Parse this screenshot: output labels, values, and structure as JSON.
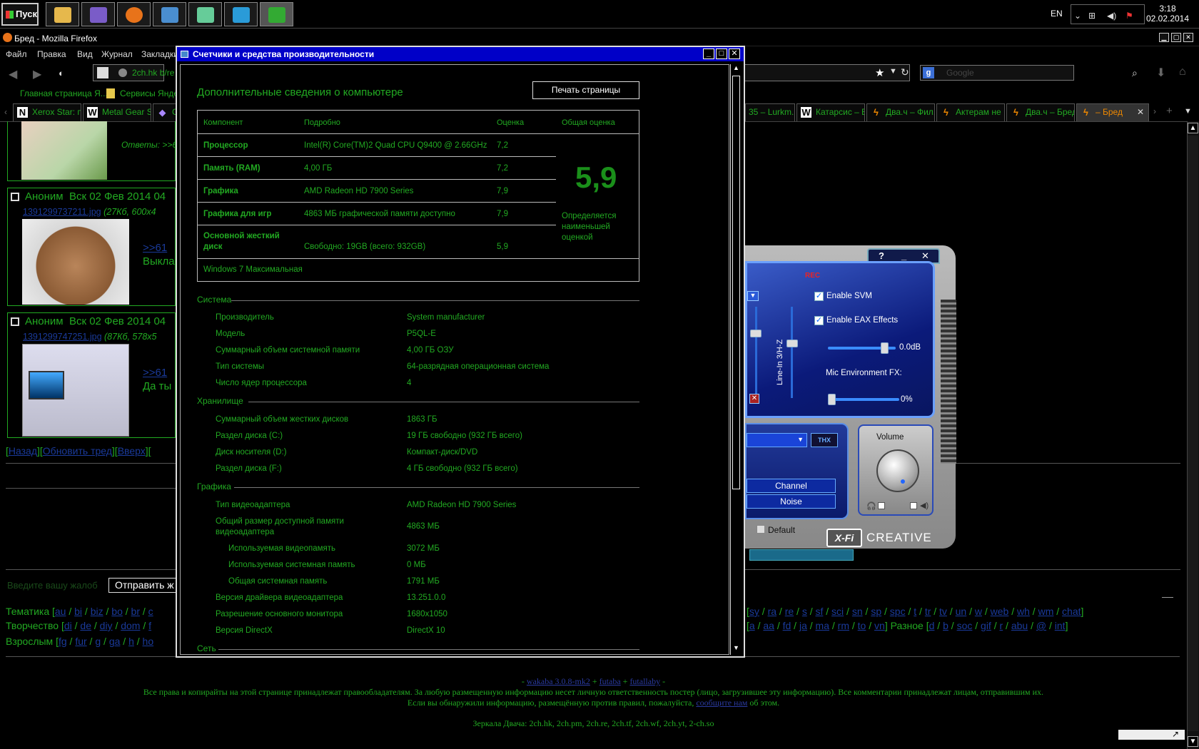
{
  "taskbar": {
    "start_label": "Пуск",
    "apps": [
      {
        "name": "explorer",
        "color": "#e6b84c"
      },
      {
        "name": "visual-studio",
        "color": "#7a5cc8"
      },
      {
        "name": "firefox",
        "color": "#e8731a"
      },
      {
        "name": "control-panel",
        "color": "#4a8ed0"
      },
      {
        "name": "network",
        "color": "#6c9"
      },
      {
        "name": "media",
        "color": "#2a9bd8"
      },
      {
        "name": "performance-monitor",
        "color": "#3a3",
        "active": true
      }
    ],
    "lang": "EN",
    "clock_time": "3:18",
    "clock_date": "02.02.2014"
  },
  "firefox": {
    "title": "Бред - Mozilla Firefox",
    "menu": [
      "Файл",
      "Правка",
      "Вид",
      "Журнал",
      "Закладки"
    ],
    "url": "2ch.hk b/re",
    "search_placeholder": "Google",
    "bookmarks": [
      "Главная страница Я...",
      "Сервисы Яндекс"
    ],
    "tabs_left": [
      "Xerox Star: пу...",
      "Metal Gear S...",
      "Co"
    ],
    "tabs_right": [
      "35 – Lurkm...",
      "Катарсис – В...",
      "Два.ч – Фил...",
      "Актерам не ...",
      "Два.ч – Бред",
      "– Бред"
    ]
  },
  "board": {
    "post1": {
      "replies": "Ответы: >>6"
    },
    "post2": {
      "author": "Аноним",
      "date": "Вск 02 Фев 2014 04",
      "file": "1391299737211.jpg",
      "meta": "(27Кб, 600x4",
      "link": ">>61",
      "text": "Выкла"
    },
    "post3": {
      "author": "Аноним",
      "date": "Вск 02 Фев 2014 04",
      "file": "1391299747251.jpg",
      "meta": "(87Кб, 578x5",
      "link": ">>61",
      "text": "Да ты"
    },
    "nav": {
      "back": "Назад",
      "refresh": "Обновить тред",
      "up": "Вверх"
    },
    "complaint_placeholder": "Введите вашу жалоб",
    "complaint_button": "Отправить ж",
    "boards": {
      "themes_label": "Тематика",
      "themes_left": [
        "au",
        "bi",
        "biz",
        "bo",
        "br",
        "c"
      ],
      "themes_right": [
        "sy",
        "ra",
        "re",
        "s",
        "sf",
        "sci",
        "sn",
        "sp",
        "spc",
        "t",
        "tr",
        "tv",
        "un",
        "w",
        "web",
        "wh",
        "wm",
        "chat"
      ],
      "creative_label": "Творчество",
      "creative_left": [
        "di",
        "de",
        "diy",
        "dom",
        "f"
      ],
      "japan_right": [
        "a",
        "aa",
        "fd",
        "ja",
        "ma",
        "rm",
        "to",
        "vn"
      ],
      "misc_label": "Разное",
      "misc": [
        "d",
        "b",
        "soc",
        "gif",
        "r",
        "abu",
        "@",
        "int"
      ],
      "adult_label": "Взрослым",
      "adult": [
        "fg",
        "fur",
        "g",
        "ga",
        "h",
        "ho"
      ]
    },
    "footer": {
      "engine_left": "wakaba 3.0.8-mk2",
      "engine_mid": "futaba",
      "engine_right": "futallaby",
      "copyright": "Все права и копирайты на этой странице принадлежат правообладателям. За любую размещенную информацию несет личную ответственность постер (лицо, загрузившее эту информацию). Все комментарии принадлежат лицам, отправившим их.",
      "report_prefix": "Если вы обнаружили информацию, размещённую против правил, пожалуйста,",
      "report_link": "сообщите нам",
      "report_suffix": "об этом.",
      "mirrors": "Зеркала Двача: 2ch.hk, 2ch.pm, 2ch.re, 2ch.tf, 2ch.wf, 2ch.yt, 2-ch.so"
    }
  },
  "dialog": {
    "title": "Счетчики и средства производительности",
    "heading": "Дополнительные сведения о компьютере",
    "print_button": "Печать страницы",
    "table_headers": [
      "Компонент",
      "Подробно",
      "Оценка",
      "Общая оценка"
    ],
    "rows": [
      {
        "component": "Процессор",
        "detail": "Intel(R) Core(TM)2 Quad CPU Q9400 @ 2.66GHz",
        "score": "7,2"
      },
      {
        "component": "Память (RAM)",
        "detail": "4,00 ГБ",
        "score": "7,2"
      },
      {
        "component": "Графика",
        "detail": "AMD Radeon HD 7900 Series",
        "score": "7,9"
      },
      {
        "component": "Графика для игр",
        "detail": "4863 МБ графической памяти доступно",
        "score": "7,9"
      },
      {
        "component": "Основной жесткий диск",
        "detail": "Свободно: 19GB (всего: 932GB)",
        "score": "5,9"
      }
    ],
    "overall": "5,9",
    "overall_note": "Определяется наименьшей оценкой",
    "edition": "Windows 7 Максимальная",
    "system": {
      "title": "Система",
      "items": [
        [
          "Производитель",
          "System manufacturer"
        ],
        [
          "Модель",
          "P5QL-E"
        ],
        [
          "Суммарный объем системной памяти",
          "4,00 ГБ ОЗУ"
        ],
        [
          "Тип системы",
          "64-разрядная операционная система"
        ],
        [
          "Число ядер процессора",
          "4"
        ]
      ]
    },
    "storage": {
      "title": "Хранилище",
      "items": [
        [
          "Суммарный объем жестких дисков",
          "1863 ГБ"
        ],
        [
          "Раздел диска (C:)",
          "19 ГБ свободно (932 ГБ всего)"
        ],
        [
          "Диск носителя (D:)",
          "Компакт-диск/DVD"
        ],
        [
          "Раздел диска (F:)",
          "4 ГБ свободно (932 ГБ всего)"
        ]
      ]
    },
    "graphics": {
      "title": "Графика",
      "adapter_type": [
        "Тип видеоадаптера",
        "AMD Radeon HD 7900 Series"
      ],
      "total_mem_label": "Общий размер доступной памяти видеоадаптера",
      "total_mem": "4863 МБ",
      "sub": [
        [
          "Используемая видеопамять",
          "3072 МБ"
        ],
        [
          "Используемая системная память",
          "0 МБ"
        ],
        [
          "Общая системная память",
          "1791 МБ"
        ]
      ],
      "rest": [
        [
          "Версия драйвера видеоадаптера",
          "13.251.0.0"
        ],
        [
          "Разрешение основного монитора",
          "1680x1050"
        ],
        [
          "Версия DirectX",
          "DirectX 10"
        ]
      ]
    },
    "network": {
      "title": "Сеть"
    }
  },
  "creative": {
    "controls": [
      "?",
      "_",
      "✕"
    ],
    "rec": "REC",
    "enable_svm": "Enable SVM",
    "enable_eax": "Enable EAX Effects",
    "gain": "0.0dB",
    "mic_fx_label": "Mic Environment FX:",
    "mic_fx": "0%",
    "line_in": "Line-In 3/H-Z",
    "thx": "THX",
    "channel": "Channel",
    "noise": "Noise",
    "volume": "Volume",
    "default": "Default",
    "logo": "X-Fi",
    "brand": "CREATIVE"
  }
}
